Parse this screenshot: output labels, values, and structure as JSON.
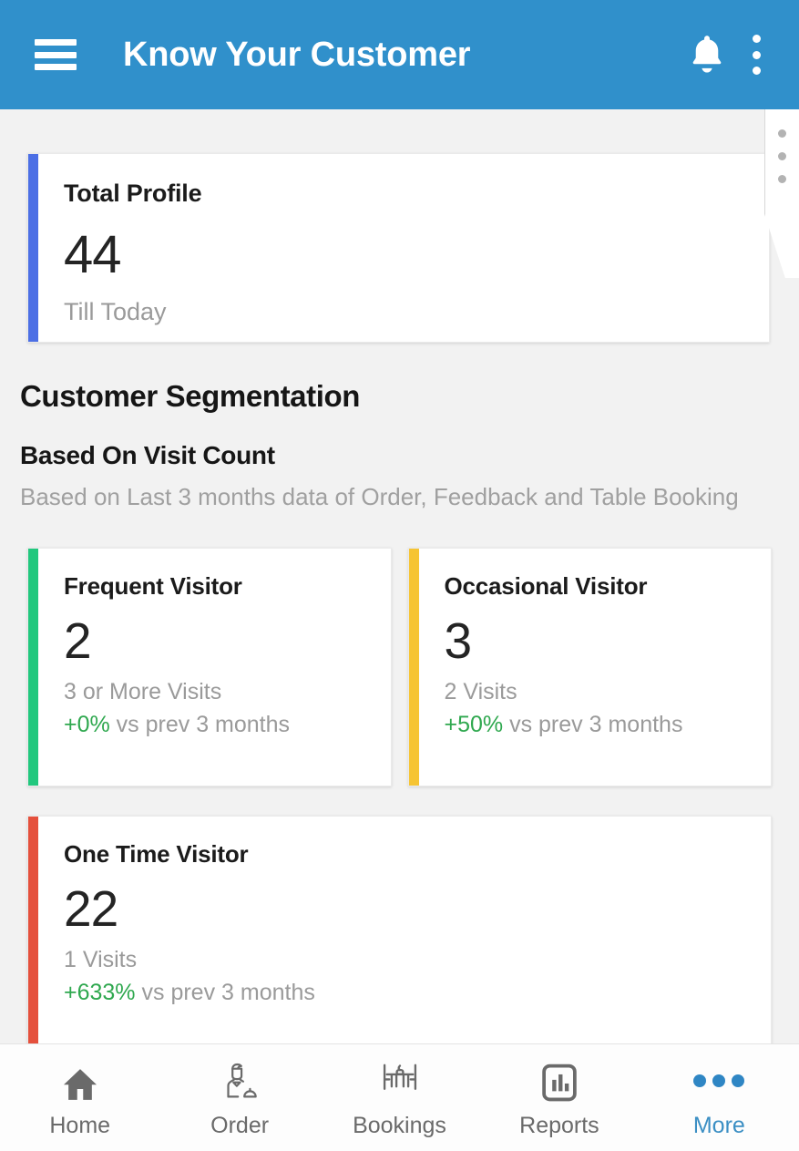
{
  "appbar": {
    "title": "Know Your Customer",
    "menu_icon": "hamburger-menu-icon",
    "notification_icon": "bell-icon",
    "overflow_icon": "kebab-menu-icon",
    "background_color": "#3090cb"
  },
  "drawer_tab": {
    "handle_icon": "vertical-dots-handle-icon"
  },
  "total_profile": {
    "title": "Total Profile",
    "value": "44",
    "subtitle": "Till Today",
    "accent_color": "#4c6fe5"
  },
  "segmentation": {
    "section_title": "Customer Segmentation",
    "group_title": "Based On Visit Count",
    "group_desc": "Based on Last 3 months data of Order, Feedback and Table Booking",
    "cards": [
      {
        "title": "Frequent Visitor",
        "value": "2",
        "subtitle": "3 or More Visits",
        "delta": "+0%",
        "delta_suffix": " vs prev 3 months",
        "accent_color": "#22c87e",
        "delta_color": "#2fa84f"
      },
      {
        "title": "Occasional Visitor",
        "value": "3",
        "subtitle": "2 Visits",
        "delta": "+50%",
        "delta_suffix": " vs prev 3 months",
        "accent_color": "#f6c433",
        "delta_color": "#2fa84f"
      },
      {
        "title": "One Time Visitor",
        "value": "22",
        "subtitle": "1 Visits",
        "delta": "+633%",
        "delta_suffix": " vs prev 3 months",
        "accent_color": "#e5503c",
        "delta_color": "#2fa84f"
      }
    ]
  },
  "bottom_nav": {
    "active_color": "#3b8fc4",
    "inactive_color": "#6a6a6a",
    "items": [
      {
        "label": "Home",
        "icon": "home-icon",
        "active": false
      },
      {
        "label": "Order",
        "icon": "waiter-icon",
        "active": false
      },
      {
        "label": "Bookings",
        "icon": "dining-table-icon",
        "active": false
      },
      {
        "label": "Reports",
        "icon": "bar-chart-icon",
        "active": false
      },
      {
        "label": "More",
        "icon": "three-dots-icon",
        "active": true
      }
    ]
  }
}
